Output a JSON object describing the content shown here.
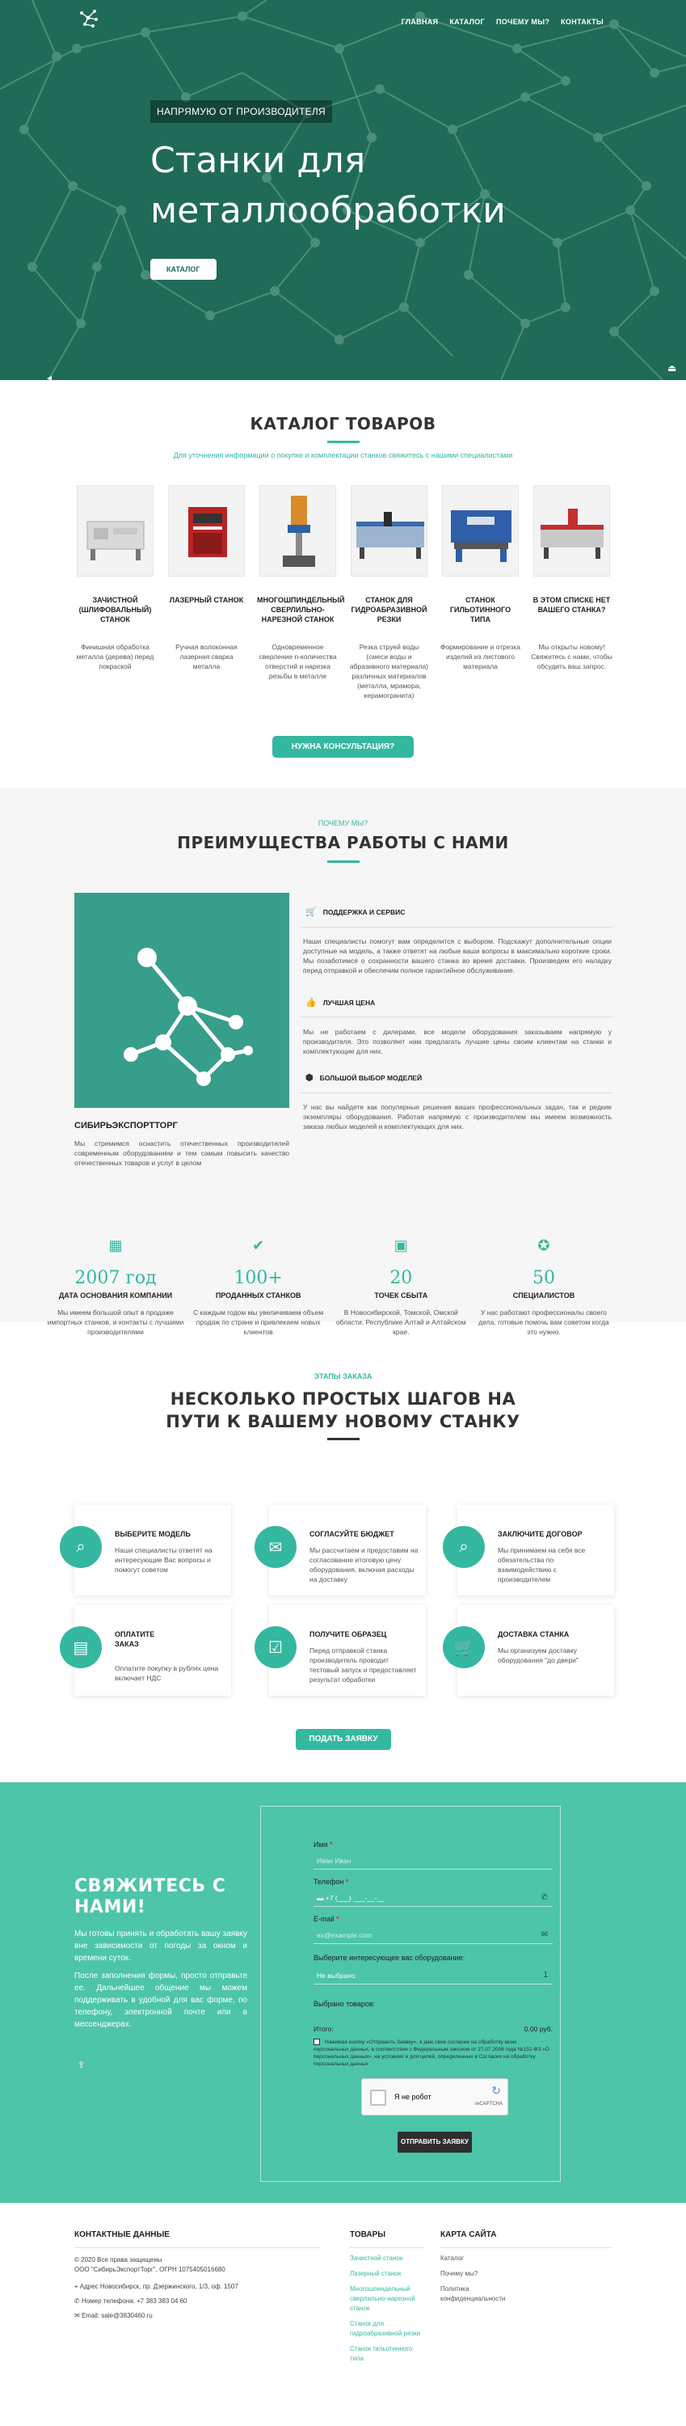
{
  "nav": {
    "items": [
      "ГЛАВНАЯ",
      "КАТАЛОГ",
      "ПОЧЕМУ МЫ?",
      "КОНТАКТЫ"
    ]
  },
  "hero": {
    "badge": "НАПРЯМУЮ ОТ ПРОИЗВОДИТЕЛЯ",
    "title_line1": "Станки для",
    "title_line2": "металлообработки",
    "button": "КАТАЛОГ"
  },
  "catalog": {
    "title": "КАТАЛОГ ТОВАРОВ",
    "subtitle": "Для уточнения информации о покупке и комплектации станков свяжитесь с нашими специалистами",
    "items": [
      {
        "name": "Зачистной (шлифовальный) станок",
        "desc": "Финишная обработка металла (дерева) перед покраской"
      },
      {
        "name": "Лазерный станок",
        "desc": "Ручная волоконная лазерная сварка металла"
      },
      {
        "name": "Многошпиндельный сверлильно-нарезной станок",
        "desc": "Одновременное сверление n-количества отверстий и нарезка резьбы в металле"
      },
      {
        "name": "Станок для гидроабразивной резки",
        "desc": "Резка струей воды (смеси воды и абразивного материала) различных материалов (металла, мрамора, керамогранита)"
      },
      {
        "name": "Станок гильотинного типа",
        "desc": "Формирование и отрезка изделий из листового материала"
      },
      {
        "name": "В этом списке нет вашего станка?",
        "desc": "Мы открыты новому! Свяжитесь с нами, чтобы обсудить ваш запрос."
      }
    ],
    "consult_button": "НУЖНА КОНСУЛЬТАЦИЯ?"
  },
  "advantages": {
    "kicker": "ПОЧЕМУ МЫ?",
    "title": "ПРЕИМУЩЕСТВА РАБОТЫ С НАМИ",
    "company": "СИБИРЬЭКСПОРТТОРГ",
    "company_text": "Мы стремимся оснастить отечественных производителей современным оборудованием и тем самым повысить качество отечественных товаров и услуг в целом",
    "rows": [
      {
        "title": "ПОДДЕРЖКА И СЕРВИС",
        "text": "Наши специалисты помогут вам определится с выбором. Подскажут дополнительные опции доступные на модель, а также ответят на любые ваши вопросы в максимально короткие сроки. Мы позаботимся о сохранности вашего станка во время доставки. Произведем его наладку перед отправкой и обеспечим полное гарантийное обслуживание."
      },
      {
        "title": "ЛУЧШАЯ ЦЕНА",
        "text": "Мы не работаем с дилерами, все модели оборудования заказываем напрямую у производителя. Это позволяет нам предлагать лучшие цены своим клиентам на станки и комплектующие для них."
      },
      {
        "title": "БОЛЬШОЙ ВЫБОР МОДЕЛЕЙ",
        "text": "У нас вы найдете как популярные решения ваших профессиональных задач, так и редкие экземпляры оборудования. Работая напрямую с производителем мы имеем возможность заказа любых моделей и комплектующих для них."
      }
    ],
    "stats": [
      {
        "icon": "calendar-icon",
        "num": "2007 год",
        "label": "ДАТА ОСНОВАНИЯ КОМПАНИИ",
        "desc": "Мы имеем большой опыт в продаже импортных станков, и контакты с лучшими производителями"
      },
      {
        "icon": "check-icon",
        "num": "100+",
        "label": "ПРОДАННЫХ СТАНКОВ",
        "desc": "С каждым годом мы увеличиваем объем продаж по стране и привлекаем новых клиентов"
      },
      {
        "icon": "box-icon",
        "num": "20",
        "label": "ТОЧЕК СБЫТА",
        "desc": "В Новосибирской, Томской, Омской области, Республике Алтай и Алтайском крае."
      },
      {
        "icon": "award-icon",
        "num": "50",
        "label": "СПЕЦИАЛИСТОВ",
        "desc": "У нас работают профессионалы своего дела, готовые помочь вам советом когда это нужно."
      }
    ]
  },
  "steps": {
    "kicker": "ЭТАПЫ ЗАКАЗА",
    "title_line1": "НЕСКОЛЬКО ПРОСТЫХ ШАГОВ НА",
    "title_line2": "ПУТИ К ВАШЕМУ НОВОМУ СТАНКУ",
    "items": [
      {
        "title": "ВЫБЕРИТЕ МОДЕЛЬ",
        "text": "Наши специалисты ответят на интересующие Вас вопросы и помогут советом"
      },
      {
        "title": "СОГЛАСУЙТЕ БЮДЖЕТ",
        "text": "Мы рассчитаем и предоставим на согласование итоговую цену оборудования, включая расходы на доставку"
      },
      {
        "title": "ЗАКЛЮЧИТЕ ДОГОВОР",
        "text": "Мы принимаем на себя все обязательства по взаимодействию с производителем"
      },
      {
        "title": "ОПЛАТИТЕ ЗАКАЗ",
        "text": "Оплатите покупку в рублях цена включает НДС"
      },
      {
        "title": "ПОЛУЧИТЕ ОБРАЗЕЦ",
        "text": "Перед отправкой станка производитель проводит тестовый запуск и предоставляет результат обработки"
      },
      {
        "title": "ДОСТАВКА СТАНКА",
        "text": "Мы организуем доставку оборудования \"до двери\""
      }
    ],
    "button": "ПОДАТЬ ЗАЯВКУ"
  },
  "contact": {
    "title_line1": "СВЯЖИТЕСЬ С",
    "title_line2": "НАМИ!",
    "text1": "Мы готовы принять и обработать вашу заявку вне зависимости от погоды за окном и времени суток.",
    "text2": "После заполнения формы, просто отправьте ее. Дальнейшее общение мы можем поддерживать в удобной для вас форме, по телефону, электронной почте или в мессенджерах.",
    "form": {
      "name_label": "Имя",
      "name_placeholder": "Иван Иван",
      "phone_label": "Телефон",
      "phone_value": "+7 (___) ___-__-__",
      "email_label": "E-mail",
      "email_placeholder": "ex@example.com",
      "equip_label": "Выберите интересующее вас оборудование:",
      "equip_value": "Не выбрано",
      "equip_qty": "1",
      "chosen_label": "Выбрано товаров:",
      "total_label": "Итого:",
      "total_value": "0.00 руб.",
      "agree_text": "Нажимая кнопку «Отправить Заявку», я даю свое согласие на обработку моих персональных данных, в соответствии с Федеральным законом от 27.07.2006 года №152-ФЗ «О персональных данных», на условиях и для целей, определенных в Согласии на обработку персональных данных",
      "captcha_text": "Я не робот",
      "captcha_brand": "reCAPTCHA",
      "submit": "ОТПРАВИТЬ ЗАЯВКУ"
    }
  },
  "footer": {
    "contacts_title": "КОНТАКТНЫЕ ДАННЫЕ",
    "copyright": "© 2020 Все права защищены",
    "company": "ООО \"СибирьЭкспортТорг\", ОГРН 1075405016680",
    "address": "Адрес Новосибирск, пр. Дзержинского, 1/3, оф. 1507",
    "phone": "Номер телефона: +7 383 383 04 60",
    "email": "Email: sale@3830460.ru",
    "products_title": "ТОВАРЫ",
    "products": [
      "Зачистной станок",
      "Лазерный станок",
      "Многошпиндельный сверлильно-нарезной станок",
      "Станок для гидроабразивной резки",
      "Станок гильотинного типа"
    ],
    "sitemap_title": "КАРТА САЙТА",
    "sitemap": [
      "Каталог",
      "Почему мы?",
      "Политика конфиденциальности"
    ]
  }
}
